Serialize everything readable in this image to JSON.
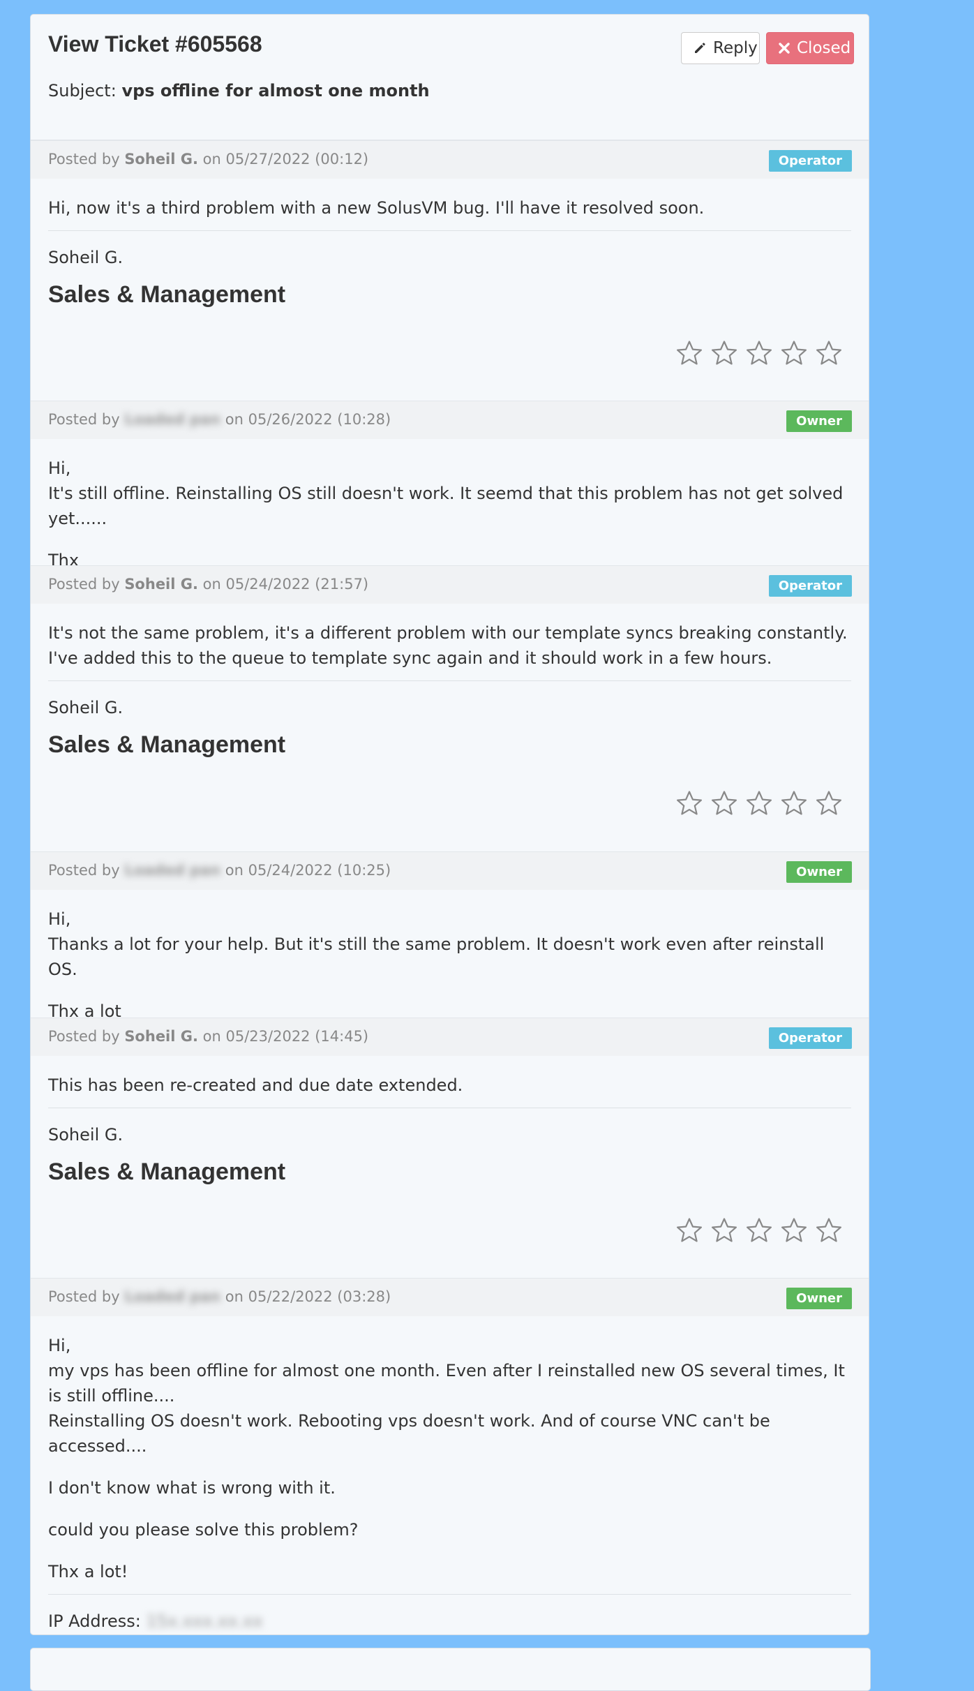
{
  "ticket": {
    "title": "View Ticket #605568",
    "subject_label": "Subject:",
    "subject": "vps offline for almost one month",
    "reply_label": "Reply",
    "closed_label": "Closed"
  },
  "posts": [
    {
      "posted_by": "Posted by",
      "author": "Soheil G.",
      "on": "on 05/27/2022 (00:12)",
      "badge": "Operator",
      "lines": [
        "Hi, now it's a third problem with a new SolusVM bug. I'll have it resolved soon."
      ],
      "signature_name": "Soheil G.",
      "signature_dept": "Sales & Management",
      "rating": 0
    },
    {
      "posted_by": "Posted by",
      "author": "Loaded pan",
      "on": "on 05/26/2022 (10:28)",
      "badge": "Owner",
      "lines": [
        "Hi,",
        "It's still offline. Reinstalling OS still doesn't work. It seemd that this problem has not get solved yet......",
        "Thx"
      ]
    },
    {
      "posted_by": "Posted by",
      "author": "Soheil G.",
      "on": "on 05/24/2022 (21:57)",
      "badge": "Operator",
      "lines": [
        "It's not the same problem, it's a different problem with our template syncs breaking constantly. I've added this to the queue to template sync again and it should work in a few hours."
      ],
      "signature_name": "Soheil G.",
      "signature_dept": "Sales & Management",
      "rating": 0
    },
    {
      "posted_by": "Posted by",
      "author": "Loaded pan",
      "on": "on 05/24/2022 (10:25)",
      "badge": "Owner",
      "lines": [
        "Hi,",
        "Thanks a lot for your help. But it's still the same problem. It doesn't work even after reinstall OS.",
        "Thx a lot"
      ]
    },
    {
      "posted_by": "Posted by",
      "author": "Soheil G.",
      "on": "on 05/23/2022 (14:45)",
      "badge": "Operator",
      "lines": [
        "This has been re-created and due date extended."
      ],
      "signature_name": "Soheil G.",
      "signature_dept": "Sales & Management",
      "rating": 0
    },
    {
      "posted_by": "Posted by",
      "author": "Loaded pan",
      "on": "on 05/22/2022 (03:28)",
      "badge": "Owner",
      "lines": [
        "Hi,",
        "my vps has been offline for almost one month. Even after I reinstalled new OS several times, It is still offline....",
        "Reinstalling OS doesn't work. Rebooting vps doesn't work. And of course VNC can't be accessed....",
        "I don't know what is wrong with it.",
        "could you please solve this problem?",
        "Thx a lot!"
      ],
      "ip_label": "IP Address:",
      "ip_value": "15x.xxx.xx.xx"
    }
  ],
  "colors": {
    "background": "#7bbffc",
    "operator_badge": "#5bc0de",
    "owner_badge": "#5cb85c",
    "closed_button": "#e8717d"
  },
  "icons": {
    "reply": "pencil-icon",
    "closed": "times-icon",
    "rating": "star-outline-icon"
  }
}
